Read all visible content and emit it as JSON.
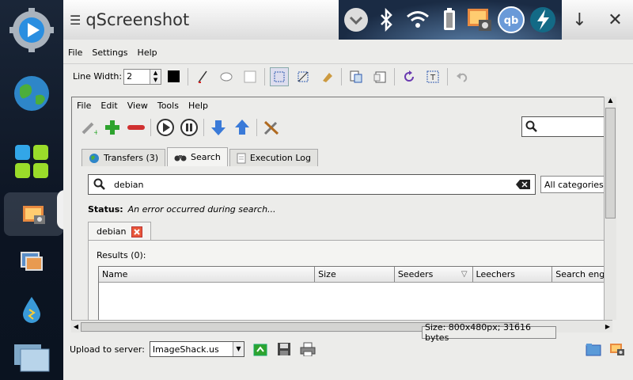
{
  "window": {
    "title": "qScreenshot"
  },
  "menubar": [
    "File",
    "Settings",
    "Help"
  ],
  "toolbar": {
    "line_width_label": "Line Width:",
    "line_width_value": "2"
  },
  "inner_window": {
    "menus": [
      "File",
      "Edit",
      "View",
      "Tools",
      "Help"
    ],
    "tabs": [
      {
        "label": "Transfers (3)",
        "icon": "globe-icon"
      },
      {
        "label": "Search",
        "icon": "binoculars-icon"
      },
      {
        "label": "Execution Log",
        "icon": "document-icon"
      }
    ],
    "search": {
      "value": "debian",
      "category": "All categories"
    },
    "status": {
      "label": "Status:",
      "message": "An error occurred during search..."
    },
    "result_tab": {
      "label": "debian"
    },
    "results_label": "Results (0):",
    "columns": [
      "Name",
      "Size",
      "Seeders",
      "Leechers",
      "Search engine"
    ]
  },
  "upload": {
    "label": "Upload to server:",
    "server": "ImageShack.us"
  },
  "size_info": "Size: 800x480px; 31616 bytes",
  "colors": {
    "accent": "#2e6fd0",
    "green": "#2ea32e",
    "red": "#d03030"
  }
}
